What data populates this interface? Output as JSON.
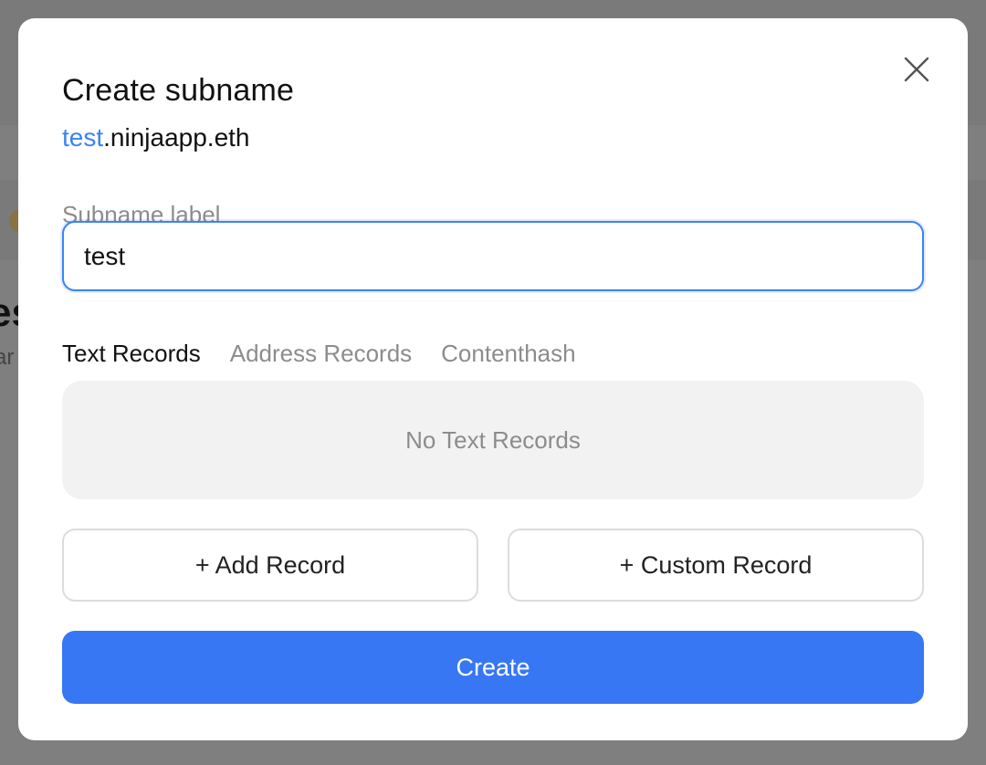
{
  "background": {
    "heading_fragment": "es",
    "sub_fragment": "ar"
  },
  "modal": {
    "title": "Create subname",
    "subtitle_label": "test",
    "subtitle_parent": ".ninjaapp.eth",
    "close_icon": "close-icon",
    "field_label": "Subname label",
    "input_value": "test",
    "tabs": [
      {
        "label": "Text Records",
        "active": true
      },
      {
        "label": "Address Records",
        "active": false
      },
      {
        "label": "Contenthash",
        "active": false
      }
    ],
    "empty_state": "No Text Records",
    "add_record_label": "+ Add Record",
    "custom_record_label": "+ Custom Record",
    "create_label": "Create"
  },
  "colors": {
    "accent": "#3b82f6",
    "primary_button": "#3777f3",
    "overlay": "#7f7f7f"
  }
}
